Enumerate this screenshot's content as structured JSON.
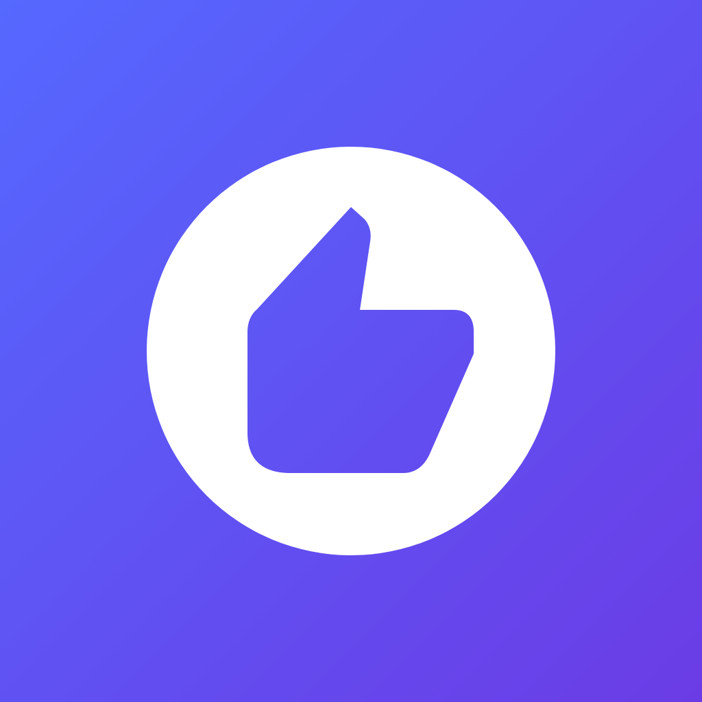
{
  "app_icon": {
    "icon": "thumbs-up-icon",
    "colors": {
      "gradient_start": "#5568FF",
      "gradient_end": "#6B3CE6",
      "badge": "#FFFFFF"
    }
  }
}
